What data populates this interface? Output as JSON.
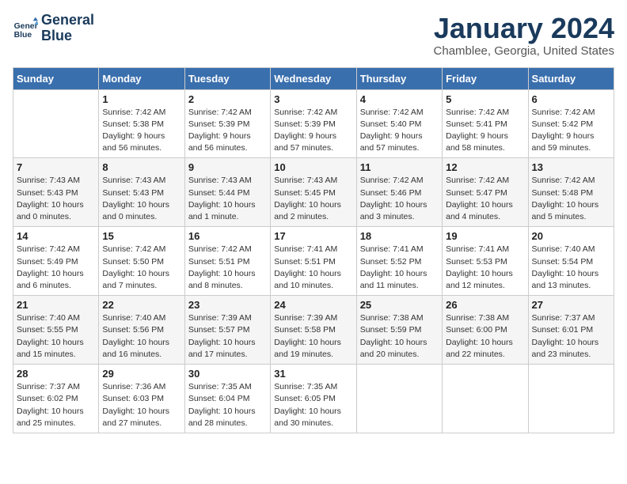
{
  "header": {
    "logo_line1": "General",
    "logo_line2": "Blue",
    "month": "January 2024",
    "location": "Chamblee, Georgia, United States"
  },
  "days_of_week": [
    "Sunday",
    "Monday",
    "Tuesday",
    "Wednesday",
    "Thursday",
    "Friday",
    "Saturday"
  ],
  "weeks": [
    [
      {
        "day": "",
        "info": ""
      },
      {
        "day": "1",
        "info": "Sunrise: 7:42 AM\nSunset: 5:38 PM\nDaylight: 9 hours\nand 56 minutes."
      },
      {
        "day": "2",
        "info": "Sunrise: 7:42 AM\nSunset: 5:39 PM\nDaylight: 9 hours\nand 56 minutes."
      },
      {
        "day": "3",
        "info": "Sunrise: 7:42 AM\nSunset: 5:39 PM\nDaylight: 9 hours\nand 57 minutes."
      },
      {
        "day": "4",
        "info": "Sunrise: 7:42 AM\nSunset: 5:40 PM\nDaylight: 9 hours\nand 57 minutes."
      },
      {
        "day": "5",
        "info": "Sunrise: 7:42 AM\nSunset: 5:41 PM\nDaylight: 9 hours\nand 58 minutes."
      },
      {
        "day": "6",
        "info": "Sunrise: 7:42 AM\nSunset: 5:42 PM\nDaylight: 9 hours\nand 59 minutes."
      }
    ],
    [
      {
        "day": "7",
        "info": "Sunrise: 7:43 AM\nSunset: 5:43 PM\nDaylight: 10 hours\nand 0 minutes."
      },
      {
        "day": "8",
        "info": "Sunrise: 7:43 AM\nSunset: 5:43 PM\nDaylight: 10 hours\nand 0 minutes."
      },
      {
        "day": "9",
        "info": "Sunrise: 7:43 AM\nSunset: 5:44 PM\nDaylight: 10 hours\nand 1 minute."
      },
      {
        "day": "10",
        "info": "Sunrise: 7:43 AM\nSunset: 5:45 PM\nDaylight: 10 hours\nand 2 minutes."
      },
      {
        "day": "11",
        "info": "Sunrise: 7:42 AM\nSunset: 5:46 PM\nDaylight: 10 hours\nand 3 minutes."
      },
      {
        "day": "12",
        "info": "Sunrise: 7:42 AM\nSunset: 5:47 PM\nDaylight: 10 hours\nand 4 minutes."
      },
      {
        "day": "13",
        "info": "Sunrise: 7:42 AM\nSunset: 5:48 PM\nDaylight: 10 hours\nand 5 minutes."
      }
    ],
    [
      {
        "day": "14",
        "info": "Sunrise: 7:42 AM\nSunset: 5:49 PM\nDaylight: 10 hours\nand 6 minutes."
      },
      {
        "day": "15",
        "info": "Sunrise: 7:42 AM\nSunset: 5:50 PM\nDaylight: 10 hours\nand 7 minutes."
      },
      {
        "day": "16",
        "info": "Sunrise: 7:42 AM\nSunset: 5:51 PM\nDaylight: 10 hours\nand 8 minutes."
      },
      {
        "day": "17",
        "info": "Sunrise: 7:41 AM\nSunset: 5:51 PM\nDaylight: 10 hours\nand 10 minutes."
      },
      {
        "day": "18",
        "info": "Sunrise: 7:41 AM\nSunset: 5:52 PM\nDaylight: 10 hours\nand 11 minutes."
      },
      {
        "day": "19",
        "info": "Sunrise: 7:41 AM\nSunset: 5:53 PM\nDaylight: 10 hours\nand 12 minutes."
      },
      {
        "day": "20",
        "info": "Sunrise: 7:40 AM\nSunset: 5:54 PM\nDaylight: 10 hours\nand 13 minutes."
      }
    ],
    [
      {
        "day": "21",
        "info": "Sunrise: 7:40 AM\nSunset: 5:55 PM\nDaylight: 10 hours\nand 15 minutes."
      },
      {
        "day": "22",
        "info": "Sunrise: 7:40 AM\nSunset: 5:56 PM\nDaylight: 10 hours\nand 16 minutes."
      },
      {
        "day": "23",
        "info": "Sunrise: 7:39 AM\nSunset: 5:57 PM\nDaylight: 10 hours\nand 17 minutes."
      },
      {
        "day": "24",
        "info": "Sunrise: 7:39 AM\nSunset: 5:58 PM\nDaylight: 10 hours\nand 19 minutes."
      },
      {
        "day": "25",
        "info": "Sunrise: 7:38 AM\nSunset: 5:59 PM\nDaylight: 10 hours\nand 20 minutes."
      },
      {
        "day": "26",
        "info": "Sunrise: 7:38 AM\nSunset: 6:00 PM\nDaylight: 10 hours\nand 22 minutes."
      },
      {
        "day": "27",
        "info": "Sunrise: 7:37 AM\nSunset: 6:01 PM\nDaylight: 10 hours\nand 23 minutes."
      }
    ],
    [
      {
        "day": "28",
        "info": "Sunrise: 7:37 AM\nSunset: 6:02 PM\nDaylight: 10 hours\nand 25 minutes."
      },
      {
        "day": "29",
        "info": "Sunrise: 7:36 AM\nSunset: 6:03 PM\nDaylight: 10 hours\nand 27 minutes."
      },
      {
        "day": "30",
        "info": "Sunrise: 7:35 AM\nSunset: 6:04 PM\nDaylight: 10 hours\nand 28 minutes."
      },
      {
        "day": "31",
        "info": "Sunrise: 7:35 AM\nSunset: 6:05 PM\nDaylight: 10 hours\nand 30 minutes."
      },
      {
        "day": "",
        "info": ""
      },
      {
        "day": "",
        "info": ""
      },
      {
        "day": "",
        "info": ""
      }
    ]
  ]
}
